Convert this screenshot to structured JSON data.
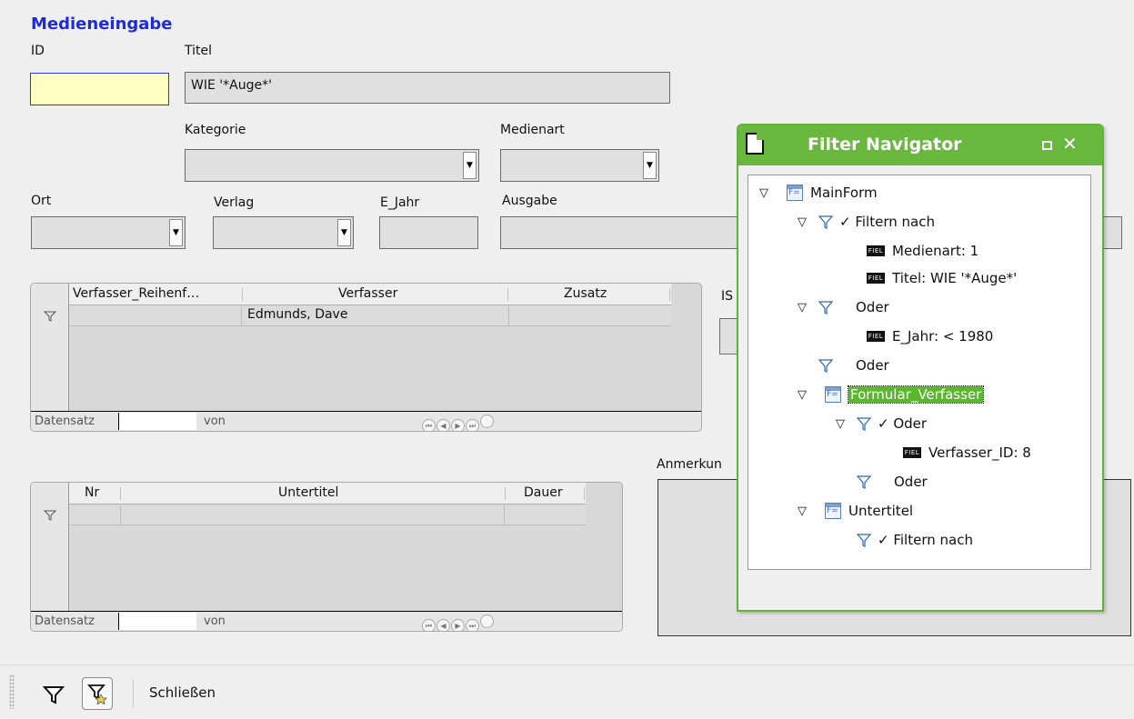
{
  "form": {
    "title": "Medieneingabe",
    "labels": {
      "id": "ID",
      "titel": "Titel",
      "kategorie": "Kategorie",
      "medienart": "Medienart",
      "ort": "Ort",
      "verlag": "Verlag",
      "e_jahr": "E_Jahr",
      "ausgabe": "Ausgabe",
      "isbn_partial": "IS",
      "anmerkung_partial": "Anmerkun"
    },
    "values": {
      "id": "",
      "titel": "WIE '*Auge*'",
      "kategorie": "",
      "medienart": "",
      "ort": "",
      "verlag": "",
      "e_jahr": "",
      "ausgabe": ""
    }
  },
  "grid_verfasser": {
    "columns": [
      "Verfasser_Reihenf…",
      "Verfasser",
      "Zusatz"
    ],
    "rows": [
      [
        "",
        "Edmunds, Dave",
        ""
      ]
    ],
    "nav": {
      "record_label": "Datensatz",
      "of_label": "von",
      "record_value": ""
    }
  },
  "grid_untertitel": {
    "columns": [
      "Nr",
      "Untertitel",
      "Dauer"
    ],
    "rows": [
      [
        "",
        "",
        ""
      ]
    ],
    "nav": {
      "record_label": "Datensatz",
      "of_label": "von",
      "record_value": ""
    }
  },
  "filter_navigator": {
    "title": "Filter Navigator",
    "tree": [
      {
        "key": "mainform",
        "label": "MainForm"
      },
      {
        "key": "filtern1",
        "label": "✓ Filtern nach"
      },
      {
        "key": "f_medienart",
        "label": "Medienart:  1"
      },
      {
        "key": "f_titel",
        "label": "Titel:  WIE '*Auge*'"
      },
      {
        "key": "oder1",
        "label": "Oder"
      },
      {
        "key": "f_ejahr",
        "label": "E_Jahr:  < 1980"
      },
      {
        "key": "oder2",
        "label": "Oder"
      },
      {
        "key": "formular_verfasser",
        "label": "Formular_Verfasser"
      },
      {
        "key": "oder3",
        "label": "✓ Oder"
      },
      {
        "key": "f_verfasser_id",
        "label": "Verfasser_ID:  8"
      },
      {
        "key": "oder4",
        "label": "Oder"
      },
      {
        "key": "untertitel",
        "label": "Untertitel"
      },
      {
        "key": "filtern2",
        "label": "✓ Filtern nach"
      }
    ],
    "field_tag": "FIEL"
  },
  "toolbar": {
    "close_label": "Schließen"
  },
  "colors": {
    "title_blue": "#1f2bd8",
    "navigator_green": "#68b83e",
    "active_field": "#ffffc4"
  }
}
